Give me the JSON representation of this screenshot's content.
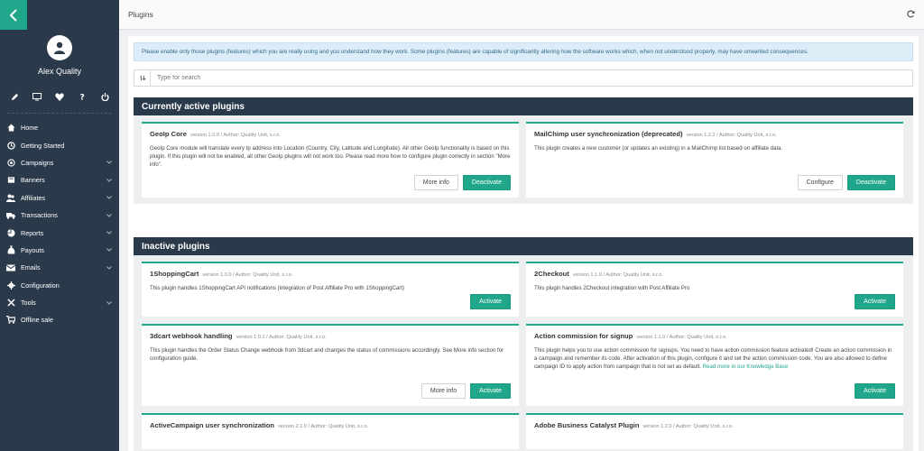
{
  "sidebar": {
    "user_name": "Alex Quality",
    "quick_icons": [
      "pencil-icon",
      "monitor-icon",
      "heart-icon",
      "help-icon",
      "power-icon"
    ],
    "items": [
      {
        "label": "Home",
        "icon": "home-icon",
        "has_children": false
      },
      {
        "label": "Getting Started",
        "icon": "clock-icon",
        "has_children": false
      },
      {
        "label": "Campaigns",
        "icon": "target-icon",
        "has_children": true
      },
      {
        "label": "Banners",
        "icon": "banner-icon",
        "has_children": true
      },
      {
        "label": "Affiliates",
        "icon": "users-icon",
        "has_children": true
      },
      {
        "label": "Transactions",
        "icon": "truck-icon",
        "has_children": true
      },
      {
        "label": "Reports",
        "icon": "chart-icon",
        "has_children": true
      },
      {
        "label": "Payouts",
        "icon": "money-bag-icon",
        "has_children": true
      },
      {
        "label": "Emails",
        "icon": "envelope-icon",
        "has_children": true
      },
      {
        "label": "Configuration",
        "icon": "gear-icon",
        "has_children": false
      },
      {
        "label": "Tools",
        "icon": "tools-icon",
        "has_children": true
      },
      {
        "label": "Offline sale",
        "icon": "cart-icon",
        "has_children": false
      }
    ]
  },
  "topbar": {
    "title": "Plugins"
  },
  "info_text": "Please enable only those plugins (features) which you are really using and you understand how they work. Some plugins (features) are capable of significantly altering how the software works which, when not understood properly, may have unwanted consequences.",
  "search": {
    "placeholder": "Type for search"
  },
  "active_section": {
    "title": "Currently active plugins",
    "plugins": [
      {
        "name": "GeoIp Core",
        "version": "version 1.0.0 / Author: Quality Unit, s.r.o.",
        "description": "GeoIp Core module will translate every Ip address into Location (Country, City, Latitude and Longitude). All other GeoIp functionality is based on this plugin. If this plugin will not be enabled, all other GeoIp plugins will not work too. Please read more how to configure plugin correctly in section \"More info\".",
        "buttons": [
          "More info",
          "Deactivate"
        ]
      },
      {
        "name": "MailChimp user synchronization (deprecated)",
        "version": "version 1.2.2 / Author: Quality Unit, s.r.o.",
        "description": "This plugin creates a new customer (or updates an existing) in a MailChimp list based on affiliate data.",
        "buttons": [
          "Configure",
          "Deactivate"
        ]
      }
    ]
  },
  "inactive_section": {
    "title": "Inactive plugins",
    "plugins": [
      {
        "name": "1ShoppingCart",
        "version": "version 1.0.0 / Author: Quality Unit, s.r.o.",
        "description": "This plugin handles 1ShoppingCart API notifications (integration of Post Affiliate Pro with 1ShoppingCart)",
        "link": "",
        "buttons": [
          "Activate"
        ]
      },
      {
        "name": "2Checkout",
        "version": "version 1.1.0 / Author: Quality Unit, s.r.o.",
        "description": "This plugin handles 2Checkout integration with Post Affiliate Pro",
        "link": "",
        "buttons": [
          "Activate"
        ]
      },
      {
        "name": "3dcart webhook handling",
        "version": "version 1.0.1 / Author: Quality Unit, s.r.o.",
        "description": "This plugin handles the Order Status Change webhook from 3dcart and changes the status of commissions accordingly. See More info section for configuration guide.",
        "link": "",
        "buttons": [
          "More info",
          "Activate"
        ]
      },
      {
        "name": "Action commission for signup",
        "version": "version 1.1.0 / Author: Quality Unit, s.r.o.",
        "description": "This plugin helps you to use action commission for signups. You need to have action commission feature activated! Create an action commission in a campaign and remember its code. After activation of this plugin, configure it and set the action commission code. You are also allowed to define campaign ID to apply action from campaign that is not set as default.",
        "link": "Read more in our Knowledge Base",
        "buttons": [
          "Activate"
        ]
      },
      {
        "name": "ActiveCampaign user synchronization",
        "version": "version 2.1.0 / Author: Quality Unit, s.r.o.",
        "description": "",
        "link": "",
        "buttons": []
      },
      {
        "name": "Adobe Business Catalyst Plugin",
        "version": "version 1.2.0 / Author: Quality Unit, s.r.o.",
        "description": "",
        "link": "",
        "buttons": []
      }
    ]
  },
  "colors": {
    "accent": "#1fa68b",
    "sidebar": "#2b3a4a",
    "info_bg": "#dcedf7"
  }
}
